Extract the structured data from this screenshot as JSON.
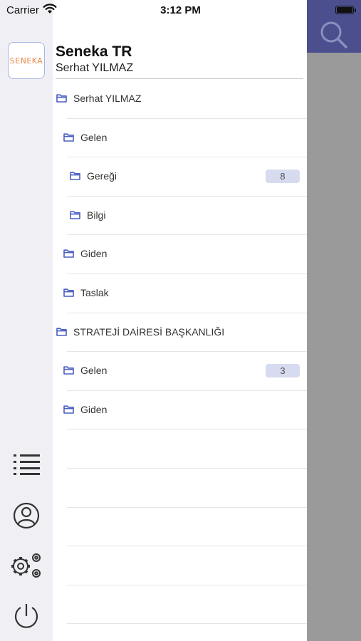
{
  "status_bar": {
    "carrier": "Carrier",
    "time": "3:12 PM"
  },
  "header": {
    "logo_text": "SENEKA",
    "org_name": "Seneka TR",
    "user_name": "Serhat YILMAZ"
  },
  "folders": [
    {
      "label": "Serhat YILMAZ",
      "level": 0,
      "badge": ""
    },
    {
      "label": "Gelen",
      "level": 1,
      "badge": ""
    },
    {
      "label": "Gereği",
      "level": 2,
      "badge": "8"
    },
    {
      "label": "Bilgi",
      "level": 2,
      "badge": ""
    },
    {
      "label": "Giden",
      "level": 1,
      "badge": ""
    },
    {
      "label": "Taslak",
      "level": 1,
      "badge": ""
    },
    {
      "label": "STRATEJİ DAİRESİ BAŞKANLIĞI",
      "level": 0,
      "badge": ""
    },
    {
      "label": "Gelen",
      "level": 1,
      "badge": "3"
    },
    {
      "label": "Giden",
      "level": 1,
      "badge": ""
    }
  ],
  "rail_icons": [
    "list-icon",
    "user-icon",
    "settings-icon",
    "power-icon"
  ],
  "colors": {
    "accent": "#4b4f8e",
    "folder": "#4a5fc1",
    "badge_bg": "#d7dbf0",
    "logo_text": "#e88947"
  }
}
